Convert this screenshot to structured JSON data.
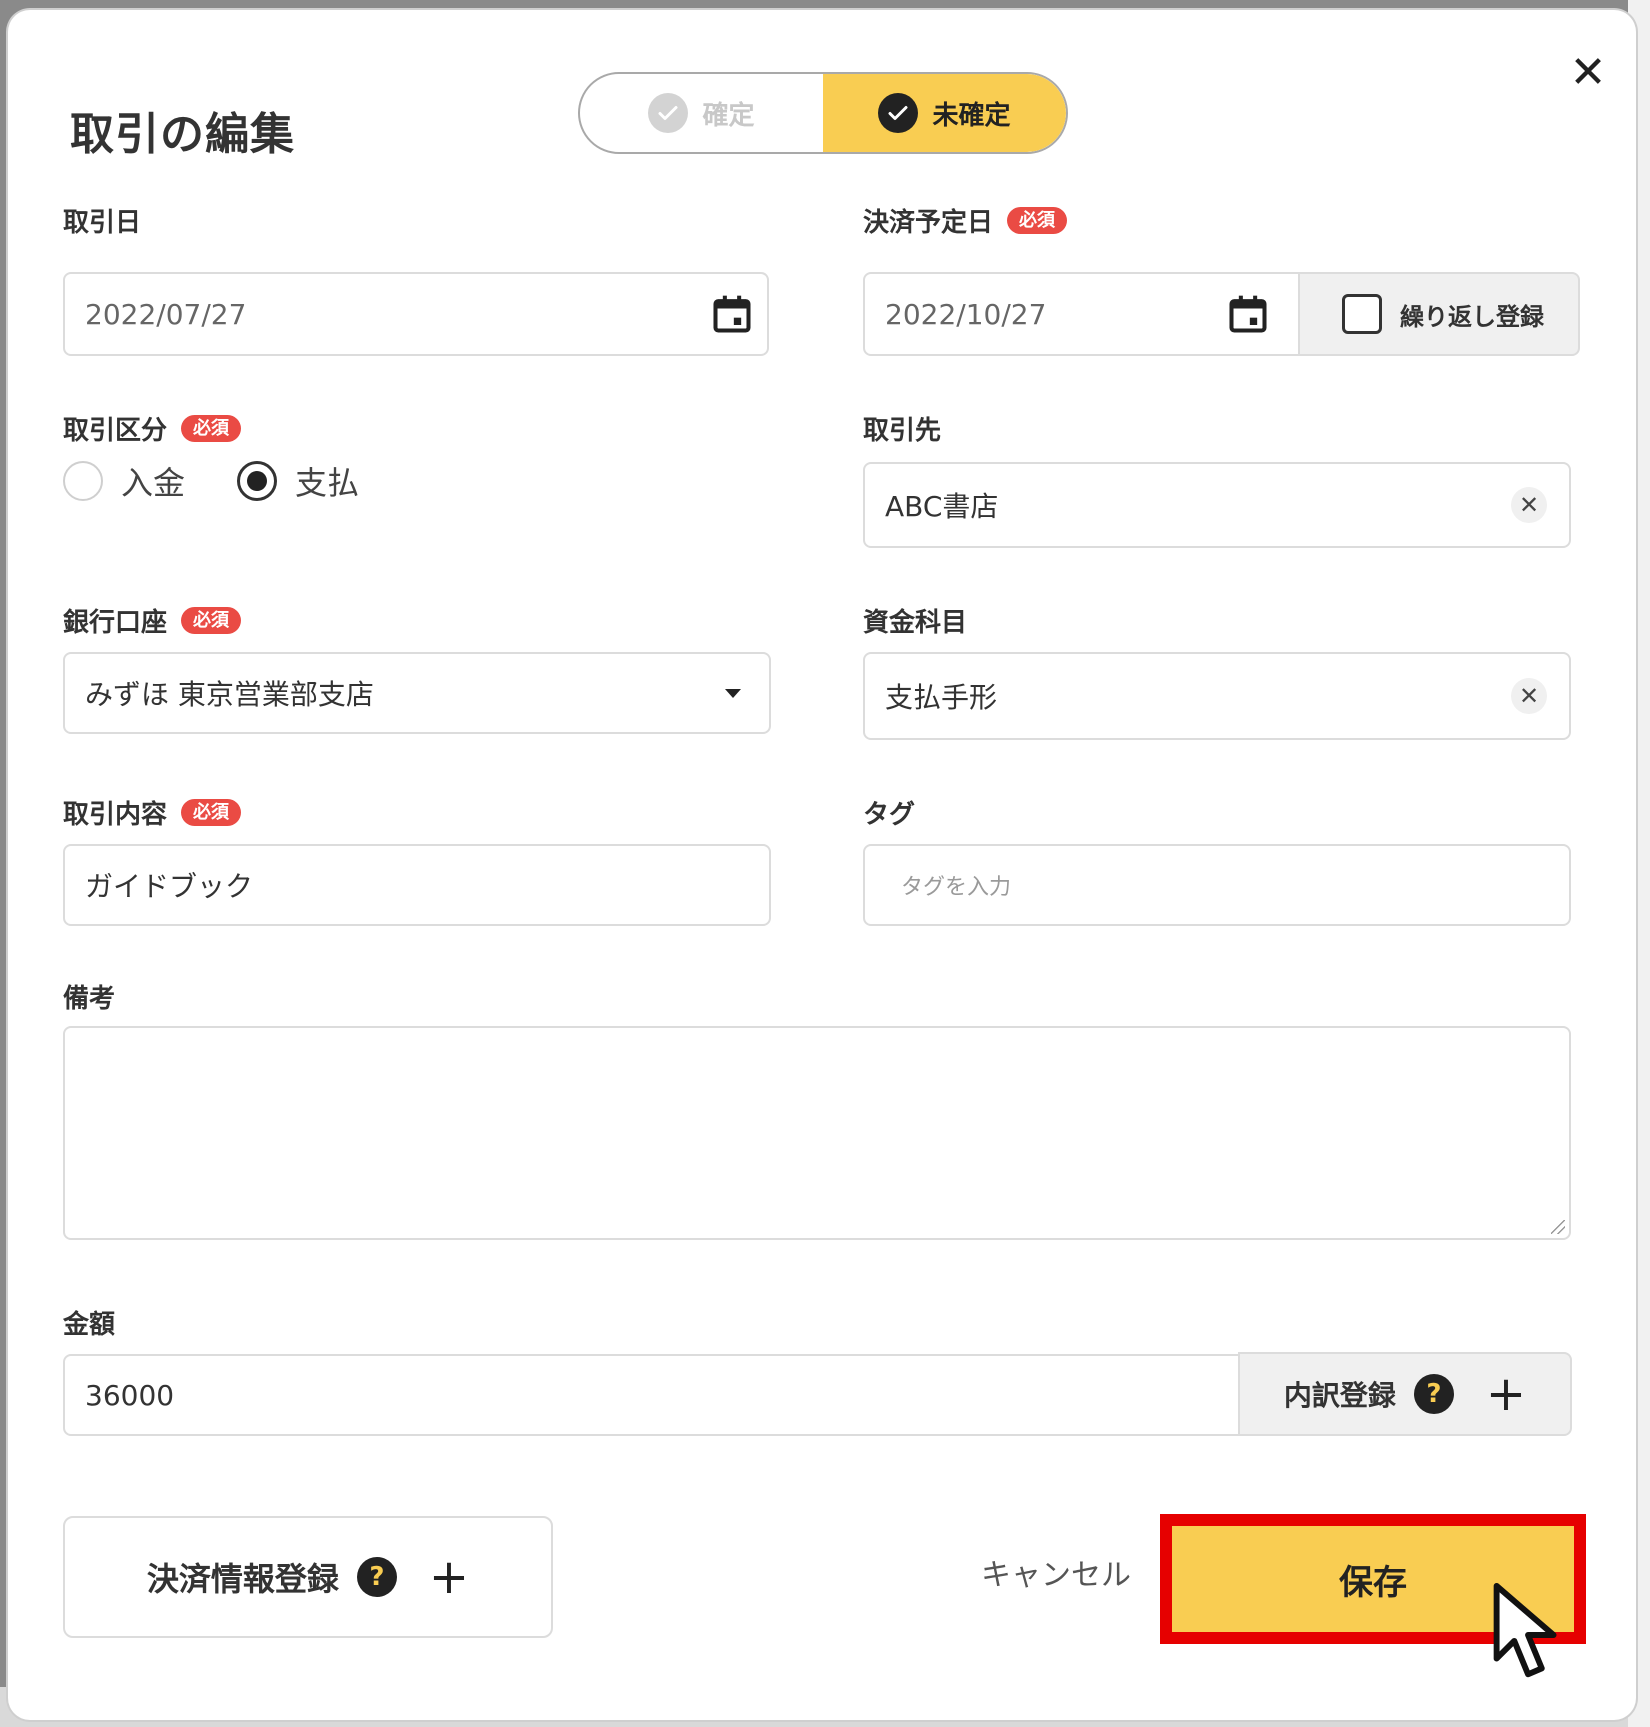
{
  "dialog": {
    "title": "取引の編集",
    "status_toggle": {
      "options": [
        {
          "label": "確定",
          "selected": false
        },
        {
          "label": "未確定",
          "selected": true
        }
      ]
    }
  },
  "fields": {
    "transaction_date": {
      "label": "取引日",
      "value": "2022/07/27"
    },
    "settlement_date": {
      "label": "決済予定日",
      "required_badge": "必須",
      "value": "2022/10/27",
      "repeat_label": "繰り返し登録"
    },
    "transaction_type": {
      "label": "取引区分",
      "required_badge": "必須",
      "options": [
        {
          "label": "入金",
          "selected": false
        },
        {
          "label": "支払",
          "selected": true
        }
      ]
    },
    "partner": {
      "label": "取引先",
      "value": "ABC書店"
    },
    "bank_account": {
      "label": "銀行口座",
      "required_badge": "必須",
      "value": "みずほ 東京営業部支店"
    },
    "fund_category": {
      "label": "資金科目",
      "value": "支払手形"
    },
    "description": {
      "label": "取引内容",
      "required_badge": "必須",
      "value": "ガイドブック"
    },
    "tags": {
      "label": "タグ",
      "placeholder": "タグを入力"
    },
    "memo": {
      "label": "備考",
      "value": ""
    },
    "amount": {
      "label": "金額",
      "value": "36000",
      "breakdown_label": "内訳登録"
    }
  },
  "actions": {
    "settlement_info_label": "決済情報登録",
    "help_glyph": "?",
    "plus_glyph": "+",
    "cancel_label": "キャンセル",
    "save_label": "保存",
    "close_glyph": "✕"
  },
  "colors": {
    "accent_yellow": "#f9cd52",
    "required_red": "#ea4b44",
    "highlight_red": "#e60000"
  }
}
